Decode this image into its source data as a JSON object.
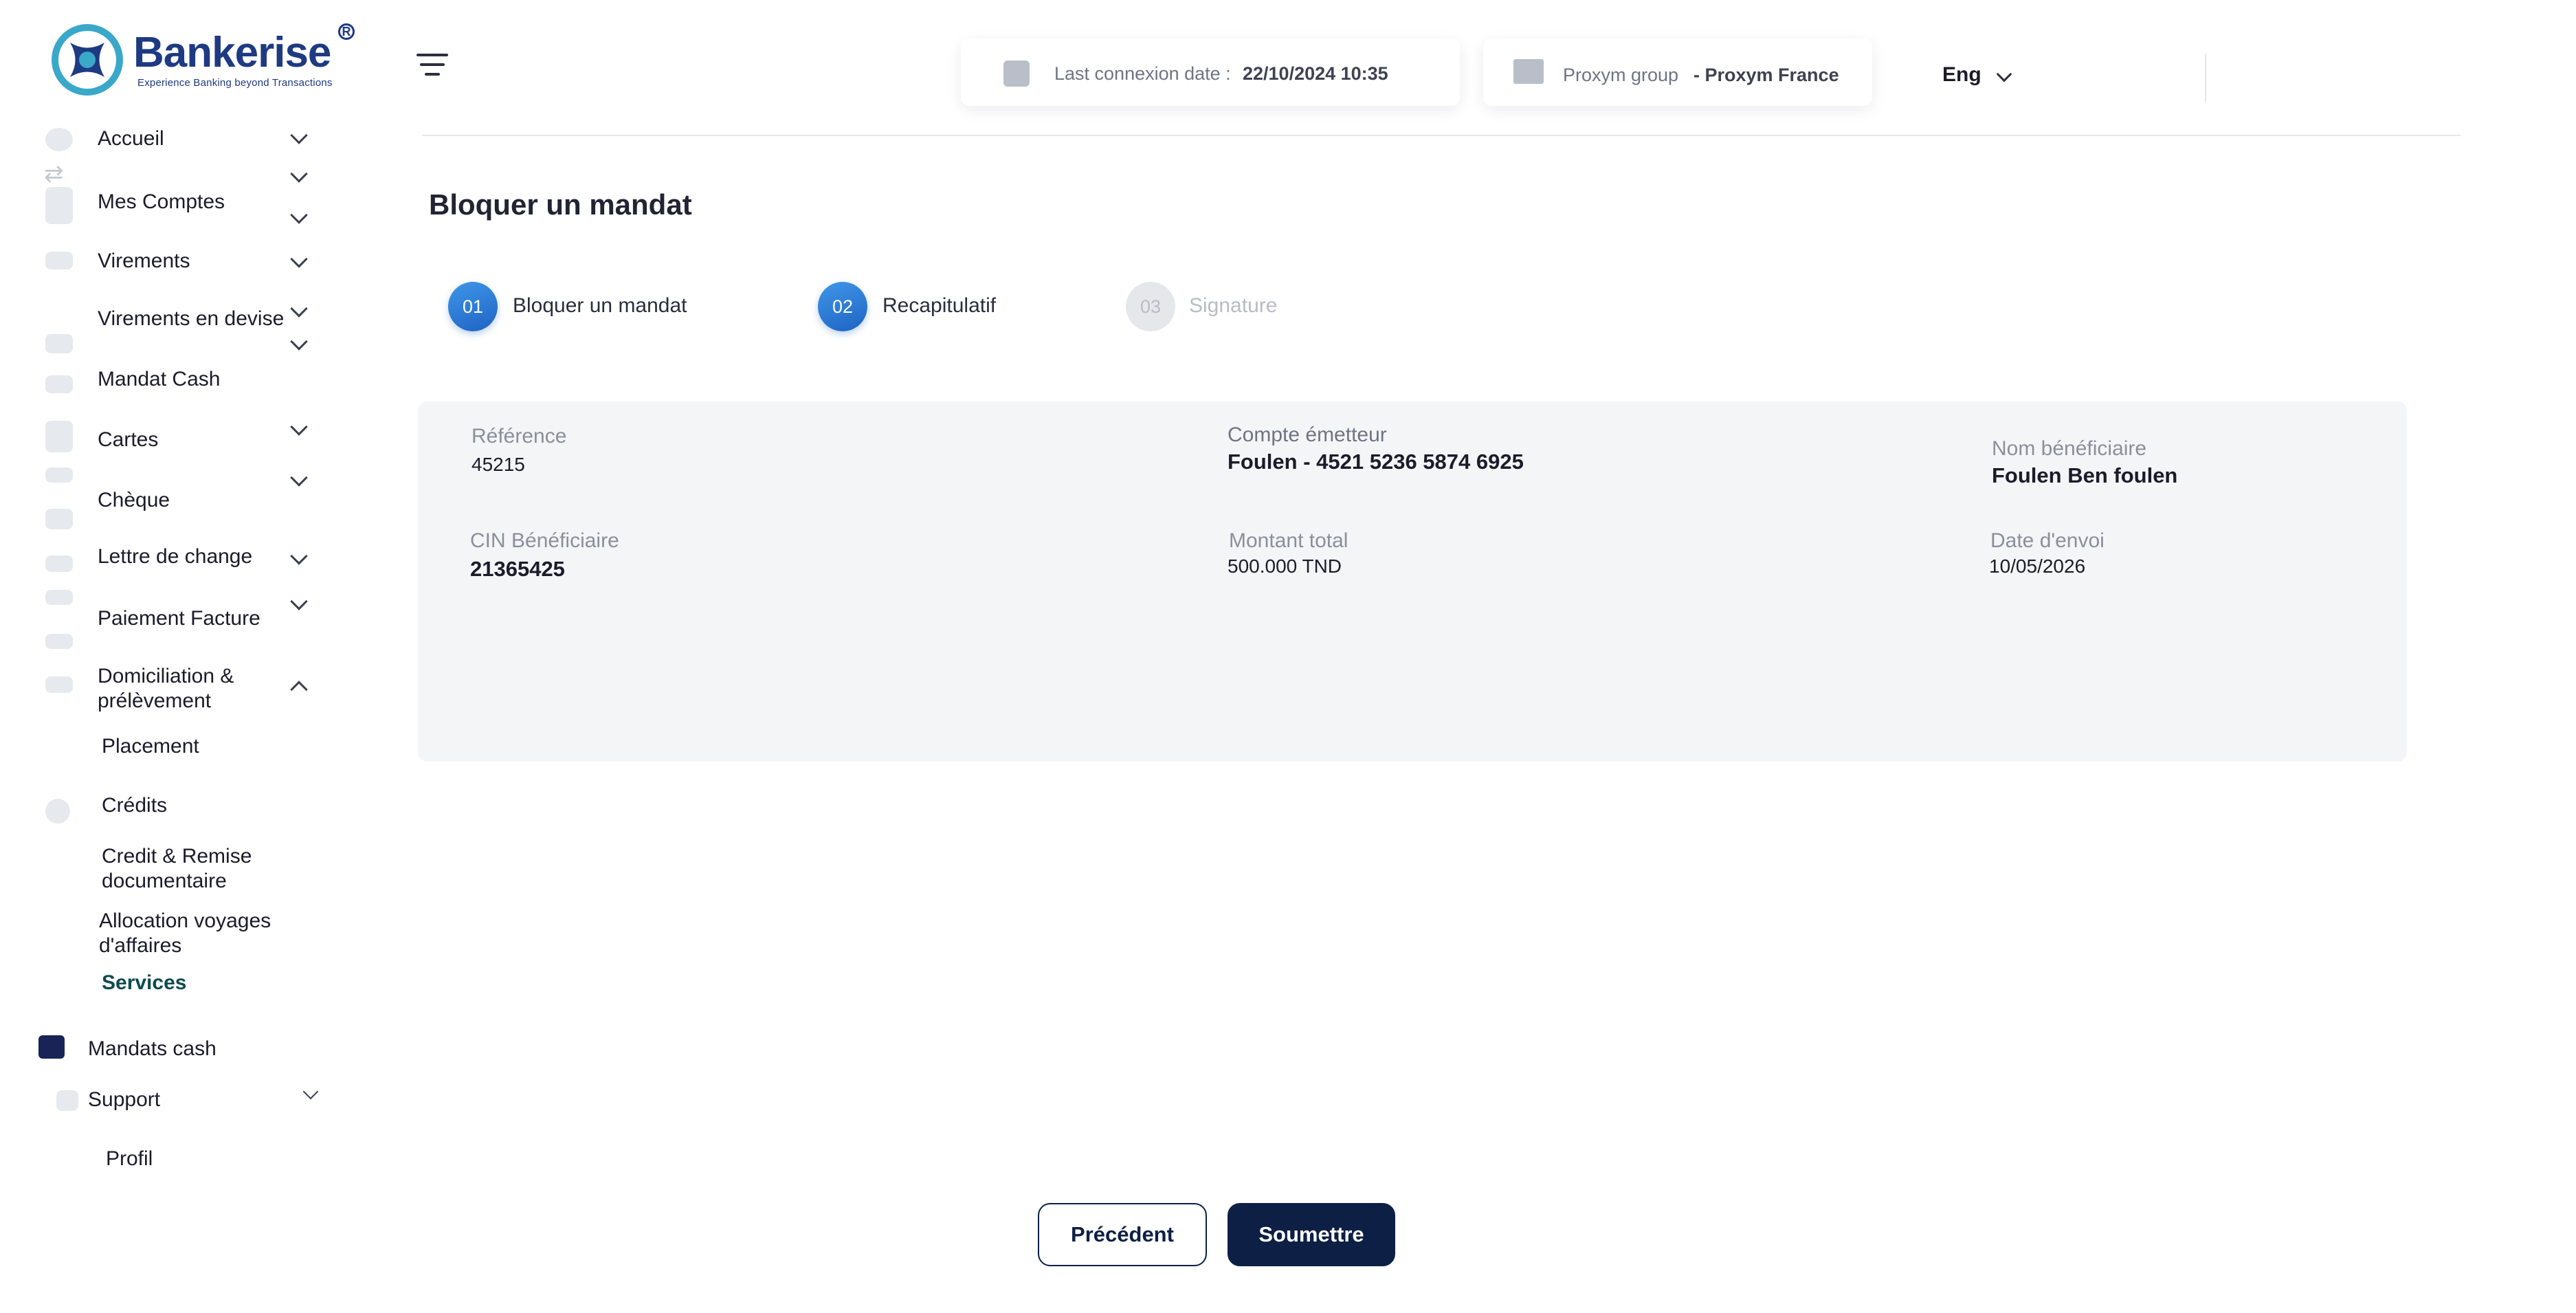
{
  "brand": {
    "name": "Bankerise",
    "tagline": "Experience Banking beyond Transactions",
    "registered": "R",
    "color": "#1e3a82"
  },
  "sidebar": {
    "items": [
      {
        "label": "Accueil",
        "icon": "home-icon"
      },
      {
        "label": "Mes Comptes",
        "icon": "wallet-icon"
      },
      {
        "label": "Virements",
        "icon": "envelope-icon"
      },
      {
        "label": "Virements en devise",
        "icon": "currency-icon"
      },
      {
        "label": "Mandat Cash",
        "icon": "envelope-icon"
      },
      {
        "label": "Cartes",
        "icon": "card-icon"
      },
      {
        "label": "Chèque",
        "icon": "cheque-icon"
      },
      {
        "label": "Lettre de change",
        "icon": "envelope-icon"
      },
      {
        "label": "Paiement Facture",
        "icon": "envelope-icon"
      },
      {
        "label": "Domiciliation & prélèvement",
        "icon": "envelope-icon"
      },
      {
        "label": "Placement",
        "icon": "chart-icon"
      },
      {
        "label": "Crédits",
        "icon": "user-icon"
      },
      {
        "label": "Credit & Remise documentaire",
        "icon": ""
      },
      {
        "label": "Allocation  voyages d'affaires",
        "icon": ""
      },
      {
        "label": "Services",
        "icon": ""
      },
      {
        "label": "Mandats cash",
        "icon": "mail-icon"
      },
      {
        "label": "Support",
        "icon": "support-icon"
      },
      {
        "label": "Profil",
        "icon": ""
      }
    ]
  },
  "header": {
    "last_connexion_label": "Last connexion date :",
    "last_connexion_value": "22/10/2024 10:35",
    "group_label": "Proxym group",
    "group_value": "- Proxym France",
    "language": "Eng"
  },
  "main": {
    "title": "Bloquer un mandat",
    "steps": [
      {
        "number": "01",
        "label": "Bloquer un mandat",
        "state": "done"
      },
      {
        "number": "02",
        "label": "Recapitulatif",
        "state": "active"
      },
      {
        "number": "03",
        "label": "Signature",
        "state": "pending"
      }
    ],
    "recap": {
      "reference_label": "Référence",
      "reference_value": "45215",
      "compte_label": "Compte émetteur",
      "compte_value": "Foulen - 4521 5236 5874 6925",
      "beneficiaire_label": "Nom bénéficiaire",
      "beneficiaire_value": "Foulen Ben foulen",
      "cin_label": "CIN Bénéficiaire",
      "cin_value": "21365425",
      "montant_label": "Montant total",
      "montant_value": "500.000 TND",
      "date_label": "Date d'envoi",
      "date_value": "10/05/2026"
    },
    "buttons": {
      "previous": "Précédent",
      "submit": "Soumettre"
    }
  },
  "colors": {
    "primary_dark": "#0d1f45",
    "step_blue": "#2b7bd6",
    "active_menu": "#0d4b4e"
  }
}
